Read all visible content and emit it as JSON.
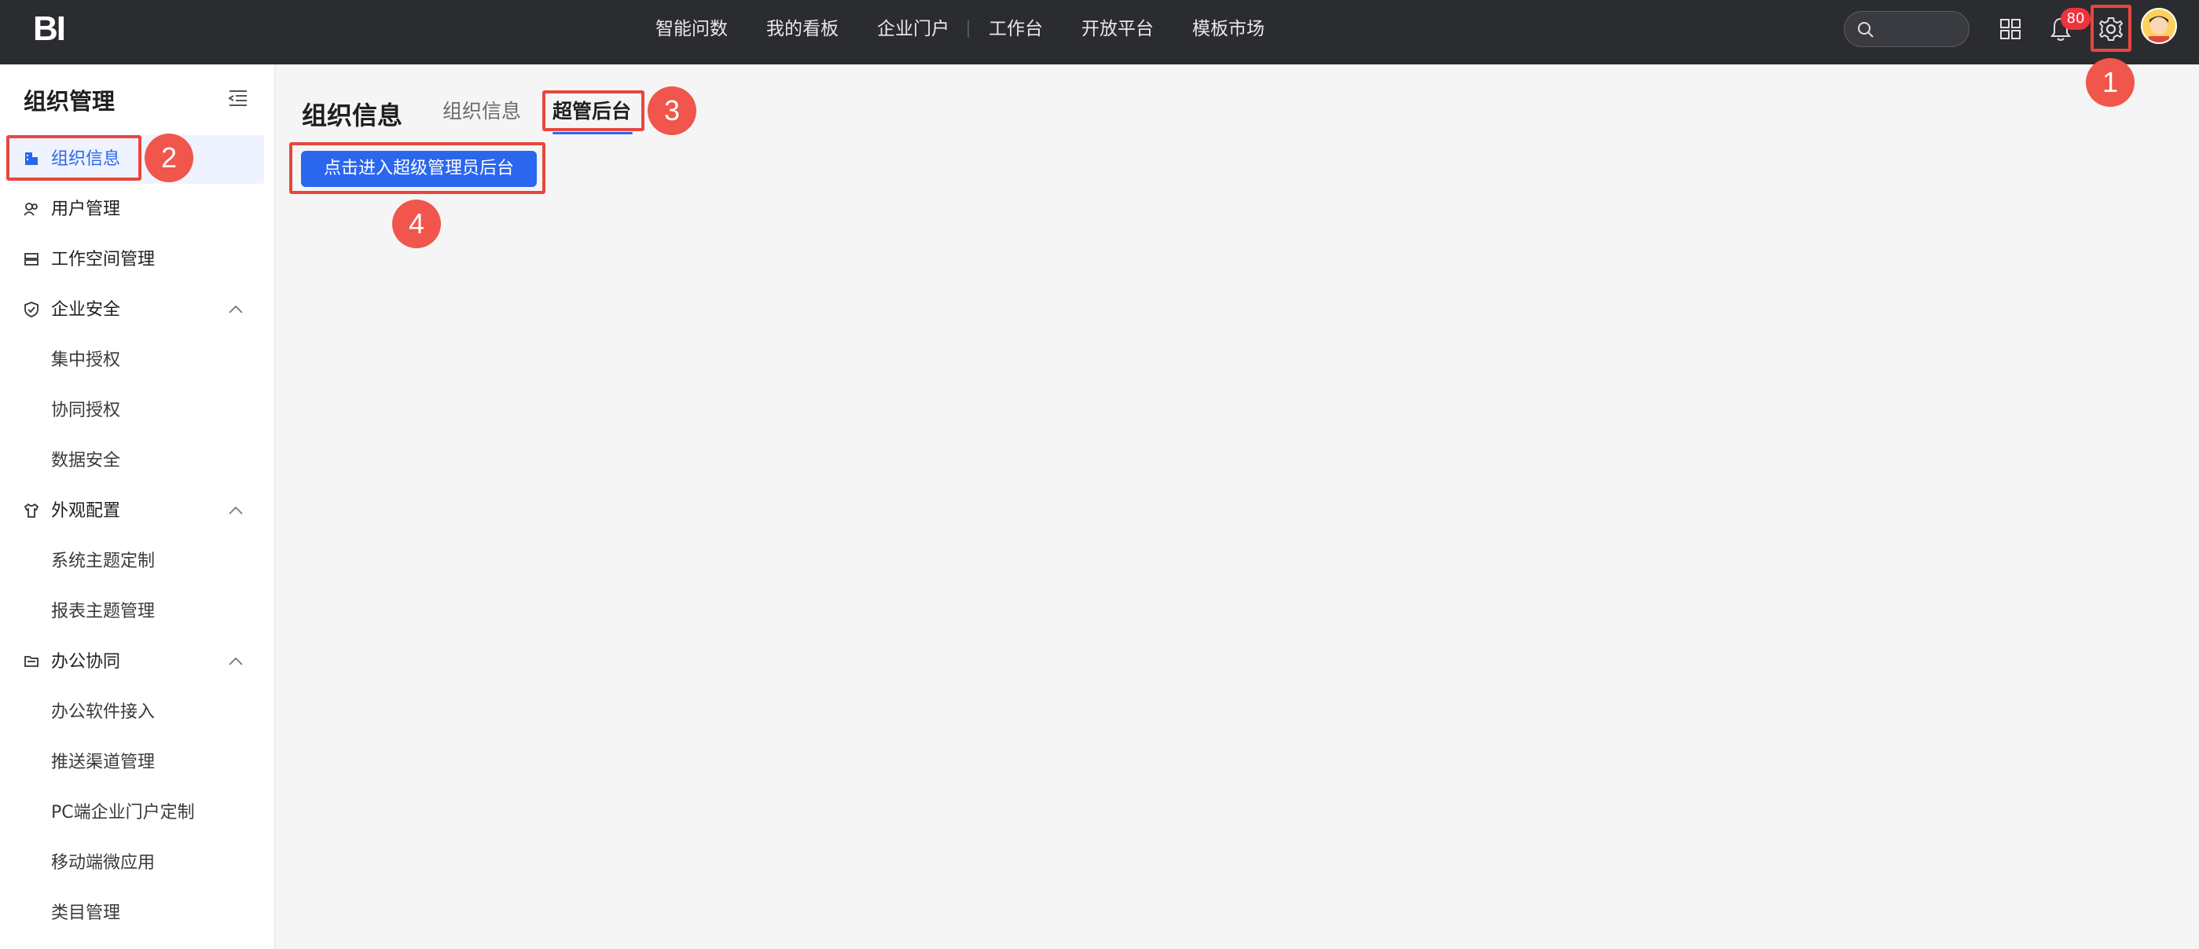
{
  "app": {
    "logo": "BI"
  },
  "topnav": {
    "items": [
      "智能问数",
      "我的看板",
      "企业门户",
      "工作台",
      "开放平台",
      "模板市场"
    ],
    "notification_count": "80"
  },
  "sidebar": {
    "title": "组织管理",
    "items": [
      {
        "label": "组织信息",
        "icon": "building-icon",
        "active": true
      },
      {
        "label": "用户管理",
        "icon": "users-icon"
      },
      {
        "label": "工作空间管理",
        "icon": "workspace-icon"
      },
      {
        "label": "企业安全",
        "icon": "shield-icon",
        "expanded": true
      },
      {
        "label": "集中授权"
      },
      {
        "label": "协同授权"
      },
      {
        "label": "数据安全"
      },
      {
        "label": "外观配置",
        "icon": "shirt-icon",
        "expanded": true
      },
      {
        "label": "系统主题定制"
      },
      {
        "label": "报表主题管理"
      },
      {
        "label": "办公协同",
        "icon": "folder-icon",
        "expanded": true
      },
      {
        "label": "办公软件接入"
      },
      {
        "label": "推送渠道管理"
      },
      {
        "label": "PC端企业门户定制"
      },
      {
        "label": "移动端微应用"
      },
      {
        "label": "类目管理"
      }
    ]
  },
  "main": {
    "title": "组织信息",
    "tabs": [
      {
        "label": "组织信息",
        "active": false
      },
      {
        "label": "超管后台",
        "active": true
      }
    ],
    "enter_button": "点击进入超级管理员后台"
  },
  "annotations": [
    "1",
    "2",
    "3",
    "4"
  ],
  "colors": {
    "accent": "#2b66ee",
    "topbar": "#2b2c30",
    "annotation": "#e8463e",
    "badge": "#f0323c"
  }
}
